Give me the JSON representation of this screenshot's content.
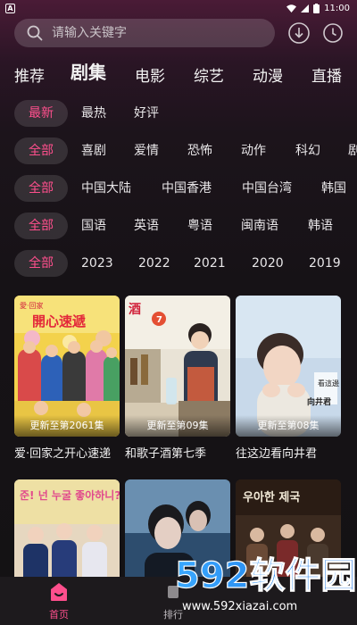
{
  "status_bar": {
    "time": "11:00",
    "badge": "A"
  },
  "search": {
    "placeholder": "请输入关键字"
  },
  "tabs": [
    {
      "label": "推荐"
    },
    {
      "label": "剧集"
    },
    {
      "label": "电影"
    },
    {
      "label": "综艺"
    },
    {
      "label": "动漫"
    },
    {
      "label": "直播"
    }
  ],
  "active_tab": "剧集",
  "filters": {
    "sort": [
      "最新",
      "最热",
      "好评"
    ],
    "genre": [
      "全部",
      "喜剧",
      "爱情",
      "恐怖",
      "动作",
      "科幻",
      "剧"
    ],
    "region": [
      "全部",
      "中国大陆",
      "中国香港",
      "中国台湾",
      "韩国"
    ],
    "language": [
      "全部",
      "国语",
      "英语",
      "粤语",
      "闽南语",
      "韩语"
    ],
    "year": [
      "全部",
      "2023",
      "2022",
      "2021",
      "2020",
      "2019"
    ]
  },
  "cards": [
    {
      "title": "爱·回家之开心速递",
      "badge": "更新至第2061集"
    },
    {
      "title": "和歌子酒第七季",
      "badge": "更新至第09集"
    },
    {
      "title": "往这边看向井君",
      "badge": "更新至第08集"
    },
    {
      "title": "",
      "badge": ""
    },
    {
      "title": "",
      "badge": ""
    },
    {
      "title": "",
      "badge": ""
    }
  ],
  "poster_text": {
    "p1_logo": "開心速遞",
    "p1_brand": "愛·回家",
    "p2_logo": "酒",
    "p2_num": "7",
    "p3_side": "向井君",
    "p3_side2": "看這邊",
    "p4_text": "준! 넌 누굴 좋아하니?",
    "p6_text": "우아한 제국"
  },
  "bottom_nav": [
    {
      "label": "首页"
    },
    {
      "label": "排行"
    }
  ],
  "watermark": {
    "brand": "592软件园",
    "url": "www.592xiazai.com"
  },
  "colors": {
    "accent": "#ff4f8d",
    "background": "#141214"
  }
}
